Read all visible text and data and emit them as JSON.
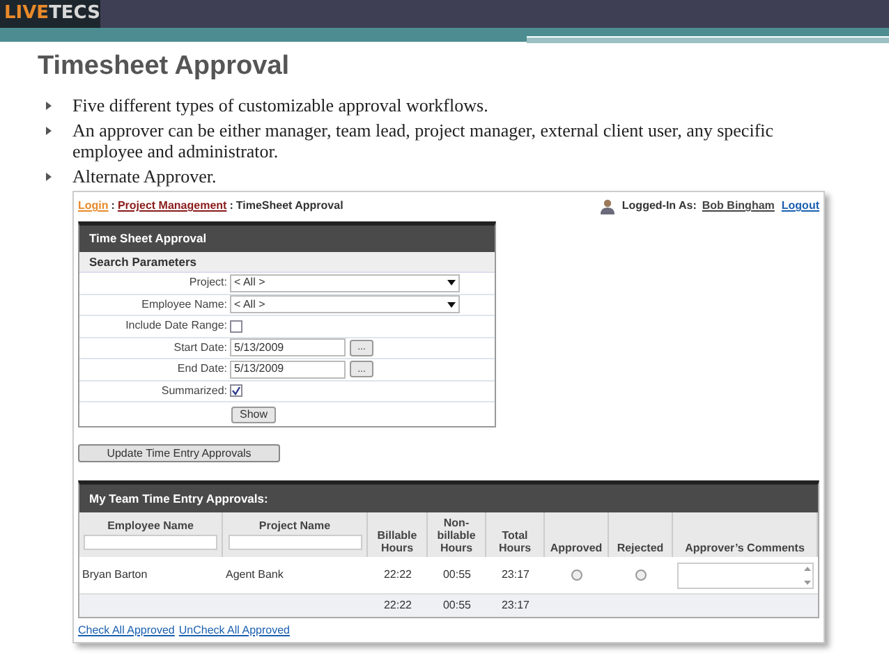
{
  "slide": {
    "logo": [
      {
        "text": "LIVE",
        "kind": "accent"
      },
      {
        "text": "TECS",
        "kind": "plain"
      }
    ],
    "title": "Timesheet Approval",
    "bullets": [
      "Five different types of customizable approval workflows.",
      "An approver can be either manager, team lead, project manager, external client user, any specific employee and administrator.",
      "Alternate  Approver."
    ]
  },
  "app": {
    "breadcrumb": [
      {
        "text": "Login",
        "kind": "visited"
      },
      {
        "text": ":",
        "kind": "separator"
      },
      {
        "text": "Project Management",
        "kind": "link"
      },
      {
        "text": ":",
        "kind": "separator"
      },
      {
        "text": "TimeSheet Approval",
        "kind": "current"
      }
    ],
    "user": {
      "label": "Logged-In As:",
      "name": "Bob Bingham",
      "logout": "Logout"
    },
    "panel": {
      "title": "Time Sheet Approval",
      "section": "Search Parameters",
      "fields": [
        {
          "label": "Project:",
          "kind": "select",
          "value": "< All >"
        },
        {
          "label": "Employee Name:",
          "kind": "select",
          "value": "< All >"
        },
        {
          "label": "Include Date Range:",
          "kind": "checkbox",
          "checked": false
        },
        {
          "label": "Start Date:",
          "kind": "date",
          "value": "5/13/2009",
          "button": "..."
        },
        {
          "label": "End Date:",
          "kind": "date",
          "value": "5/13/2009",
          "button": "..."
        },
        {
          "label": "Summarized:",
          "kind": "checkbox",
          "checked": true
        }
      ],
      "show_button": "Show"
    },
    "update_button": "Update Time Entry Approvals",
    "table": {
      "title": "My Team Time Entry Approvals:",
      "columns": [
        {
          "label": "Employee Name",
          "filter": true
        },
        {
          "label": "Project Name",
          "filter": true
        },
        {
          "label": "Billable Hours",
          "filter": false
        },
        {
          "label": "Non-billable Hours",
          "filter": false
        },
        {
          "label": "Total Hours",
          "filter": false
        },
        {
          "label": "Approved",
          "filter": false
        },
        {
          "label": "Rejected",
          "filter": false
        },
        {
          "label": "Approver’s Comments",
          "filter": false
        }
      ],
      "rows": [
        {
          "employee": "Bryan Barton",
          "project": "Agent Bank",
          "billable": "22:22",
          "non_billable": "00:55",
          "total": "23:17",
          "approved": false,
          "rejected": false
        }
      ],
      "totals": [
        "22:22",
        "00:55",
        "23:17"
      ]
    },
    "links": [
      "Check All Approved",
      "UnCheck All Approved"
    ]
  }
}
